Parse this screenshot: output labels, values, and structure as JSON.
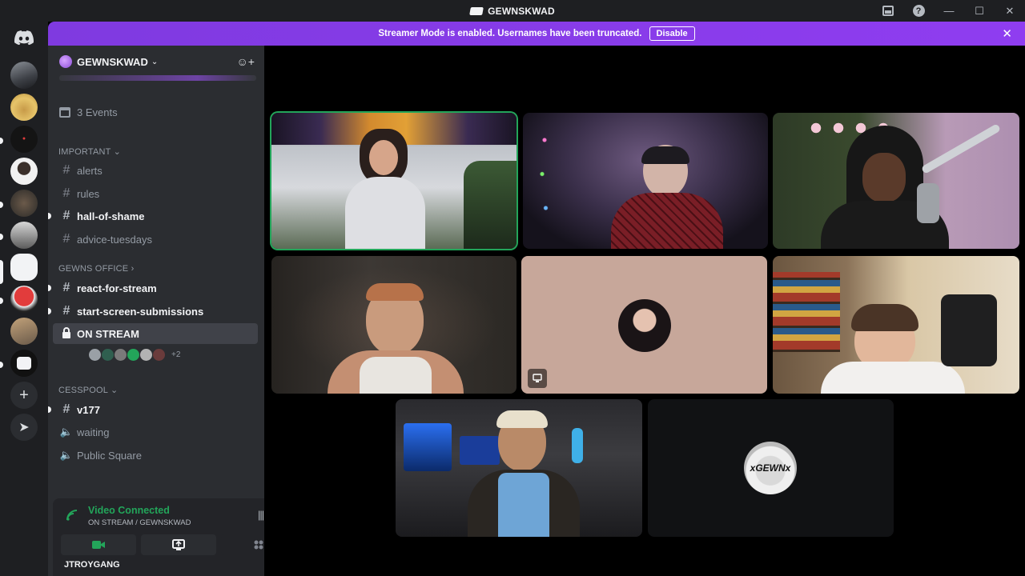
{
  "window": {
    "title": "GEWNSKWAD"
  },
  "banner": {
    "text": "Streamer Mode is enabled. Usernames have been truncated.",
    "button": "Disable"
  },
  "server": {
    "name": "GEWNSKWAD"
  },
  "events": {
    "label": "3 Events"
  },
  "categories": {
    "important": "IMPORTANT",
    "office": "GEWNS OFFICE",
    "cesspool": "CESSPOOL"
  },
  "channels": {
    "alerts": "alerts",
    "rules": "rules",
    "hall_of_shame": "hall-of-shame",
    "advice_tuesdays": "advice-tuesdays",
    "react_for_stream": "react-for-stream",
    "start_screen": "start-screen-submissions",
    "on_stream": "ON STREAM",
    "v177": "v177",
    "waiting": "waiting",
    "public_square": "Public Square"
  },
  "voice_users_more": "+2",
  "voice_panel": {
    "status": "Video Connected",
    "location": "ON STREAM / GEWNSKWAD"
  },
  "bottom_user": "JTROYGANG",
  "tiles": {
    "avatar_label": "xGEWNx"
  },
  "colors": {
    "accent_banner": "#8a2be2",
    "connected_green": "#23a55a",
    "speaking_outline": "#23a55a"
  },
  "icons": {
    "home": "discord-logo-icon",
    "add_server": "plus-icon",
    "explore": "compass-icon",
    "camera": "video-camera-icon",
    "screenshare": "screen-share-icon",
    "activities": "activities-icon"
  }
}
